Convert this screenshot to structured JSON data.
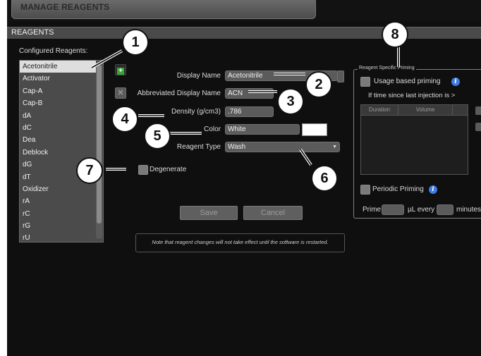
{
  "window": {
    "title": "MANAGE REAGENTS"
  },
  "section": {
    "header": "REAGENTS"
  },
  "list": {
    "label": "Configured Reagents:",
    "items": [
      "Acetonitrile",
      "Activator",
      "Cap-A",
      "Cap-B",
      "dA",
      "dC",
      "Dea",
      "Deblock",
      "dG",
      "dT",
      "Oxidizer",
      "rA",
      "rC",
      "rG",
      "rU"
    ],
    "selected": "Acetonitrile"
  },
  "form": {
    "display_name_label": "Display Name",
    "display_name_value": "Acetonitrile",
    "abbrev_label": "Abbreviated Display Name",
    "abbrev_value": "ACN",
    "density_label": "Density (g/cm3)",
    "density_value": ".786",
    "color_label": "Color",
    "color_value": "White",
    "color_swatch": "#ffffff",
    "type_label": "Reagent Type",
    "type_value": "Wash",
    "degenerate_label": "Degenerate",
    "save_label": "Save",
    "cancel_label": "Cancel",
    "note": "Note that reagent changes will not take effect until the software is restarted."
  },
  "priming": {
    "group_title": "Reagent Specific Priming",
    "usage_label": "Usage based priming",
    "if_time_label": "If time since last injection is >",
    "columns": [
      "Duration",
      "Volume"
    ],
    "periodic_label": "Periodic Priming",
    "prime_label": "Prime",
    "ul_every_label": "µL every",
    "minutes_label": "minutes"
  },
  "callouts": [
    "1",
    "2",
    "3",
    "4",
    "5",
    "6",
    "7",
    "8"
  ],
  "icons": {
    "add": "plus-icon",
    "delete": "x-icon",
    "info": "info-icon"
  },
  "colors": {
    "add_green": "#3aa63a",
    "info_blue": "#3f7be0"
  }
}
